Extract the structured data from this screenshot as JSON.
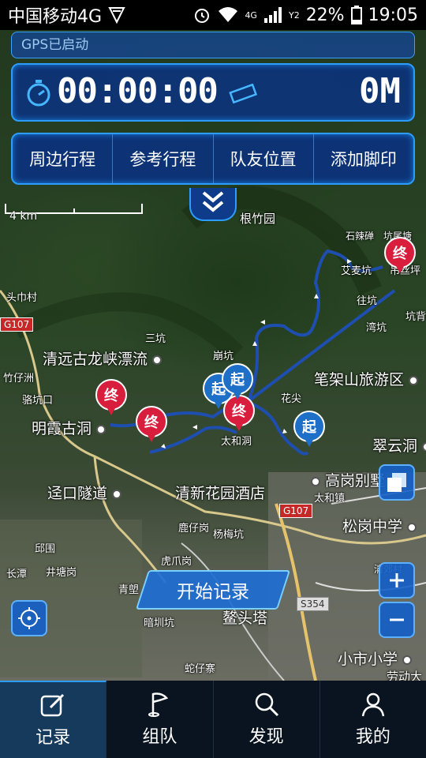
{
  "status_bar": {
    "carrier": "中国移动4G",
    "net_top": "4G",
    "net_sim": "Y2",
    "battery": "22%",
    "time": "19:05"
  },
  "gps_status": "GPS已启动",
  "timer": {
    "elapsed": "00:00:00",
    "distance": "0M"
  },
  "menu": [
    "周边行程",
    "参考行程",
    "队友位置",
    "添加脚印"
  ],
  "scale": {
    "label": "4 km"
  },
  "map_labels": {
    "genzhuyuan": "根竹园",
    "shilashi": "石辣䃅",
    "kengweitang": "坑尾塘",
    "aimaokeng": "艾麦坑",
    "shengsi": "吊丝坪",
    "wangkeng": "往坑",
    "wankeng": "湾坑",
    "kengbei": "坑背",
    "toujincun": "头巾村",
    "sankeng": "三坑",
    "bengkeng": "崩坑",
    "qingyuan": "清远古龙峡漂流",
    "zhuzizhou": "竹仔洲",
    "lukoukou": "骆坑口",
    "bijiashan": "笔架山旅游区",
    "huajian": "花尖",
    "mingxiagudong": "明霞古洞",
    "taihedong": "太和洞",
    "cuiyundong": "翠云洞",
    "kaokou": "迳口隧道",
    "qingxin": "清新花园酒店",
    "gaogangbieshu": "高岗别墅",
    "taihezhen": "太和镇",
    "songgang": "松岗中学",
    "luzaigang": "鹿仔岗",
    "yangmeikeng": "杨梅坑",
    "qiuwei": "邱围",
    "changtan": "长潭",
    "jingtanggang": "井塘岗",
    "hupagang": "虎爪岗",
    "qingli": "青塱",
    "anchoukeng": "暗圳坑",
    "aotouta": "鳌头塔",
    "qingnan": "清郊村",
    "shezaizhai": "蛇仔寨",
    "xiaoshi": "小市小学",
    "laodong": "劳动大",
    "g107_a": "G107",
    "g107_b": "G107",
    "s354": "S354"
  },
  "pins": {
    "start": "起",
    "end": "终"
  },
  "start_record": "开始记录",
  "tabs": [
    {
      "label": "记录",
      "icon": "edit-icon"
    },
    {
      "label": "组队",
      "icon": "flag-icon"
    },
    {
      "label": "发现",
      "icon": "search-icon"
    },
    {
      "label": "我的",
      "icon": "user-icon"
    }
  ],
  "colors": {
    "accent": "#2c9dff",
    "panel": "#0e3c8a",
    "track": "#1e4fb0",
    "end_pin": "#d81e3c",
    "start_pin": "#1e6fc8"
  }
}
